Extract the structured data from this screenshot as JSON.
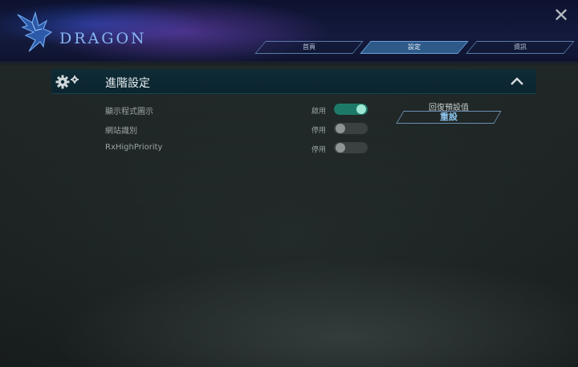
{
  "header": {
    "brand": "DRAGON",
    "close_label": "✕",
    "tabs": [
      {
        "label": "首頁",
        "active": false
      },
      {
        "label": "設定",
        "active": true
      },
      {
        "label": "資訊",
        "active": false
      }
    ]
  },
  "section": {
    "title": "進階設定",
    "icon": "gears-icon",
    "collapse_icon": "chevron-up-icon"
  },
  "settings": [
    {
      "label": "顯示程式圖示",
      "status": "啟用",
      "enabled": true
    },
    {
      "label": "網站識別",
      "status": "停用",
      "enabled": false
    },
    {
      "label": "RxHighPriority",
      "status": "停用",
      "enabled": false
    }
  ],
  "reset": {
    "caption": "回復預設值",
    "button_label": "重設"
  },
  "colors": {
    "accent": "#1e7a68",
    "toggle_knob_on": "#9fe8d4",
    "brand": "#86b6f2",
    "active_tab": "#2e5a8a"
  }
}
